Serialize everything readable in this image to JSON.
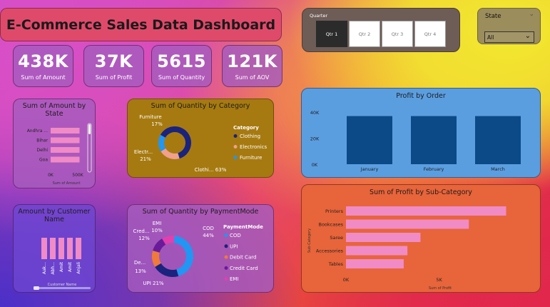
{
  "header": {
    "title": "E-Commerce Sales Data Dashboard"
  },
  "kpis": [
    {
      "value": "438K",
      "label": "Sum of Amount"
    },
    {
      "value": "37K",
      "label": "Sum of Profit"
    },
    {
      "value": "5615",
      "label": "Sum of Quantity"
    },
    {
      "value": "121K",
      "label": "Sum of AOV"
    }
  ],
  "quarter_slicer": {
    "title": "Quarter",
    "options": [
      "Qtr 1",
      "Qtr 2",
      "Qtr 3",
      "Qtr 4"
    ],
    "selected": "Qtr 1"
  },
  "state_slicer": {
    "title": "State",
    "value": "All"
  },
  "colors": {
    "profit_bar": "#0b4a86",
    "subcat_bar": "#f08bc6",
    "state_bar": "#f08bc6",
    "clothing": "#1a237e",
    "electronics": "#f0a08c",
    "furniture": "#2196f3",
    "cod": "#2196f3",
    "upi": "#1a237e",
    "debit": "#f07a3a",
    "credit": "#6a1b9a",
    "emi": "#e040b0"
  },
  "chart_data": [
    {
      "id": "amount_by_state",
      "type": "bar",
      "orientation": "horizontal",
      "title": "Sum of Amount by State",
      "categories": [
        "Andhra ...",
        "Bihar",
        "Delhi",
        "Goa"
      ],
      "values": [
        450000,
        450000,
        450000,
        450000
      ],
      "xlim": [
        0,
        600000
      ],
      "xticks": [
        "0K",
        "500K"
      ],
      "xlabel": "Sum of Amount"
    },
    {
      "id": "quantity_by_category",
      "type": "pie",
      "title": "Sum of Quantity by Category",
      "legend_title": "Category",
      "slices": [
        {
          "name": "Clothing",
          "value": 63,
          "label": "Clothi... 63%"
        },
        {
          "name": "Electronics",
          "value": 21,
          "label": "Electr... 21%"
        },
        {
          "name": "Furniture",
          "value": 17,
          "label": "Furniture 17%"
        }
      ]
    },
    {
      "id": "profit_by_order",
      "type": "bar",
      "title": "Profit by Order",
      "categories": [
        "January",
        "February",
        "March"
      ],
      "values": [
        37000,
        37000,
        37000
      ],
      "ylim": [
        0,
        45000
      ],
      "yticks": [
        {
          "v": 0,
          "t": "0K"
        },
        {
          "v": 20000,
          "t": "20K"
        },
        {
          "v": 40000,
          "t": "40K"
        }
      ]
    },
    {
      "id": "amount_by_customer",
      "type": "bar",
      "title": "Amount by Customer Name",
      "categories": [
        "Aak...",
        "Abh...",
        "Amit",
        "Amit",
        "Anjali"
      ],
      "values": [
        1,
        1,
        1,
        1,
        1
      ],
      "xlabel": "Customer Name"
    },
    {
      "id": "quantity_by_payment",
      "type": "pie",
      "title": "Sum of Quantity by PaymentMode",
      "legend_title": "PaymentMode",
      "slices": [
        {
          "name": "COD",
          "value": 44,
          "label": "COD 44%"
        },
        {
          "name": "UPI",
          "value": 21,
          "label": "UPI 21%"
        },
        {
          "name": "Debit Card",
          "value": 13,
          "label": "De... 13%"
        },
        {
          "name": "Credit Card",
          "value": 12,
          "label": "Cred... 12%"
        },
        {
          "name": "EMI",
          "value": 10,
          "label": "EMI 10%"
        }
      ]
    },
    {
      "id": "profit_by_subcategory",
      "type": "bar",
      "orientation": "horizontal",
      "title": "Sum of Profit by Sub-Category",
      "categories": [
        "Printers",
        "Bookcases",
        "Saree",
        "Accessories",
        "Tables"
      ],
      "values": [
        8600,
        6600,
        4000,
        3300,
        3100
      ],
      "xlim": [
        0,
        9500
      ],
      "xticks": [
        {
          "v": 0,
          "t": "0K"
        },
        {
          "v": 5000,
          "t": "5K"
        }
      ],
      "xlabel": "Sum of Profit",
      "ylabel": "Sub-Category"
    }
  ]
}
